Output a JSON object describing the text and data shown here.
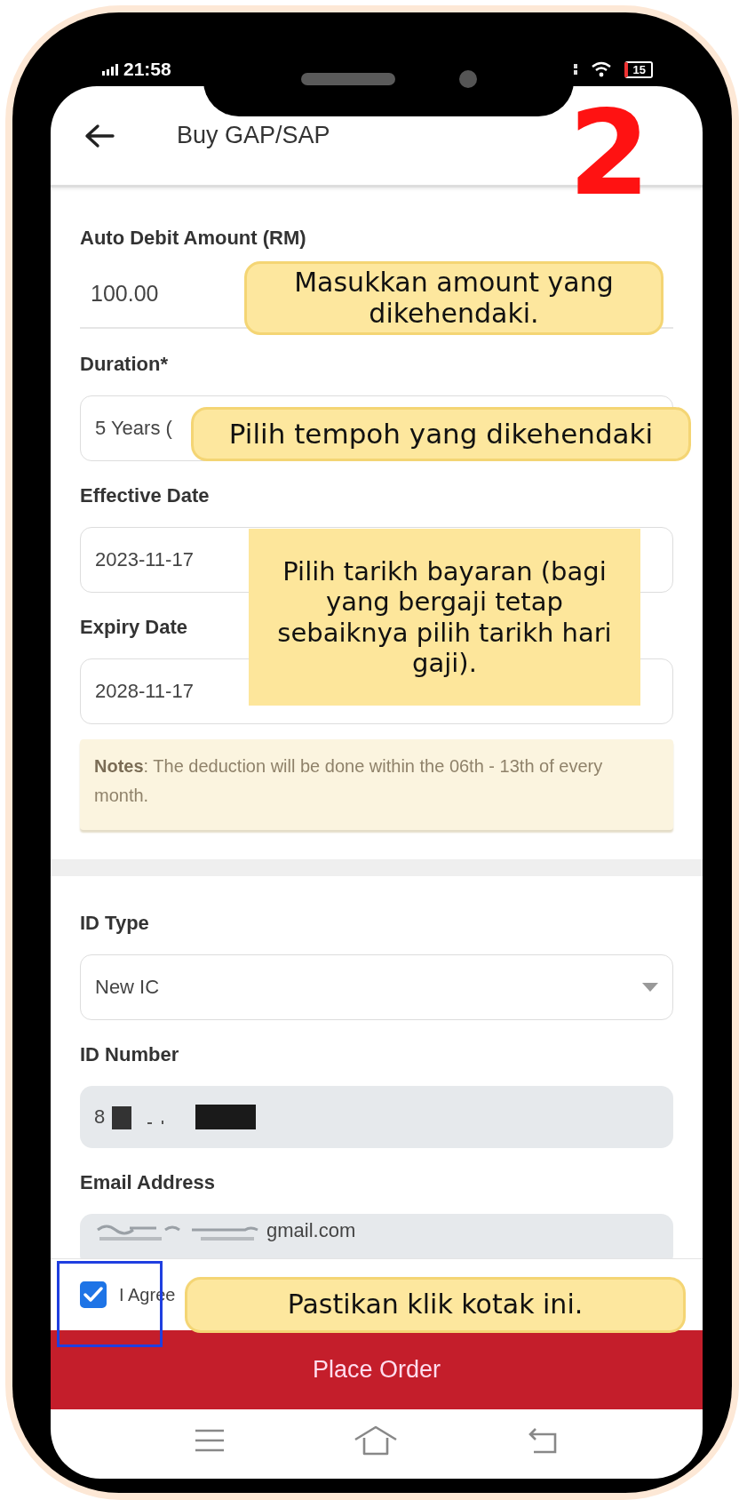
{
  "status_bar": {
    "time": "21:58",
    "battery": "15"
  },
  "header": {
    "title": "Buy GAP/SAP"
  },
  "step_number": "2",
  "form": {
    "fields": [
      {
        "label": "Auto Debit Amount (RM)",
        "value": "100.00",
        "kind": "underline"
      },
      {
        "label": "Duration*",
        "value": "5 Years (",
        "kind": "outlined"
      },
      {
        "label": "Effective Date",
        "value": "2023-11-17",
        "kind": "outlined"
      },
      {
        "label": "Expiry Date",
        "value": "2028-11-17",
        "kind": "outlined"
      }
    ],
    "notes": "**Notes**: The deduction will be done within the 06th - 13th of every month."
  },
  "identity": {
    "fields": [
      {
        "label": "ID Type",
        "value": "New IC",
        "kind": "select"
      },
      {
        "label": "ID Number",
        "value": "8",
        "kind": "readonly",
        "redacted_before": false,
        "redacted_after": true
      },
      {
        "label": "Email Address",
        "value": "gmail.com",
        "kind": "readonly",
        "redacted_before": true,
        "redacted_after": false
      }
    ]
  },
  "agreement": {
    "label": "I Agree",
    "checked": true
  },
  "place_order_button": "Place Order",
  "annotations": [
    {
      "text": "Masukkan amount yang dikehendaki.",
      "kind": "pill"
    },
    {
      "text": "Pilih tempoh yang dikehendaki",
      "kind": "pill"
    },
    {
      "text": "Pilih tarikh bayaran (bagi yang bergaji tetap sebaiknya pilih tarikh hari gaji).",
      "kind": "box"
    },
    {
      "text": "Pastikan klik kotak ini.",
      "kind": "pill"
    }
  ]
}
